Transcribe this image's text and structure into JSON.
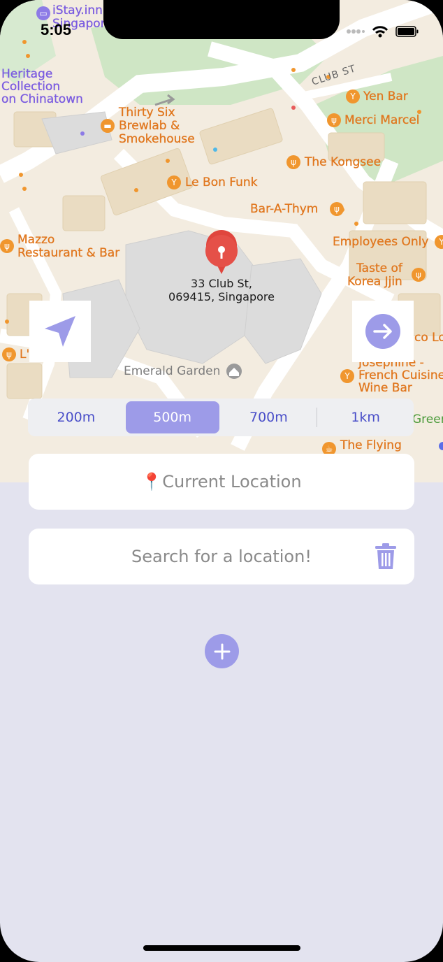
{
  "status_bar": {
    "time": "5:05"
  },
  "map": {
    "pin_address_line1": "33 Club St,",
    "pin_address_line2": "069415, Singapore",
    "street": "CLUB ST",
    "labels": {
      "istay_1": "iStay.inn",
      "istay_2": "Singapore",
      "heritage_1": "Heritage",
      "heritage_2": "Collection",
      "heritage_3": "on Chinatown",
      "thirtysix_1": "Thirty Six",
      "thirtysix_2": "Brewlab &",
      "thirtysix_3": "Smokehouse",
      "yen_bar": "Yen Bar",
      "merci_marcel": "Merci Marcel",
      "kongsee": "The Kongsee",
      "le_bon_funk": "Le Bon Funk",
      "bar_a_thym": "Bar-A-Thym",
      "mazzo_1": "Mazzo",
      "mazzo_2": "Restaurant & Bar",
      "employees_only": "Employees Only",
      "taste_korea_1": "Taste of",
      "taste_korea_2": "Korea Jjin",
      "emerald_garden": "Emerald Garden",
      "coco_lo": "co Lo",
      "josephine_1": "Josephine -",
      "josephine_2": "French Cuisine",
      "josephine_3": "Wine Bar",
      "green": "Green",
      "flying": "The Flying",
      "l_partial": "L'"
    }
  },
  "distance_options": [
    "200m",
    "500m",
    "700m",
    "1km"
  ],
  "distance_selected": "500m",
  "current_location": "📍Current Location",
  "search_placeholder": "Search for a location!",
  "colors": {
    "accent": "#9d9be8",
    "segment_text": "#4a4fc9",
    "panel_bg": "#e3e3ef",
    "poi_orange": "#e0761d"
  }
}
